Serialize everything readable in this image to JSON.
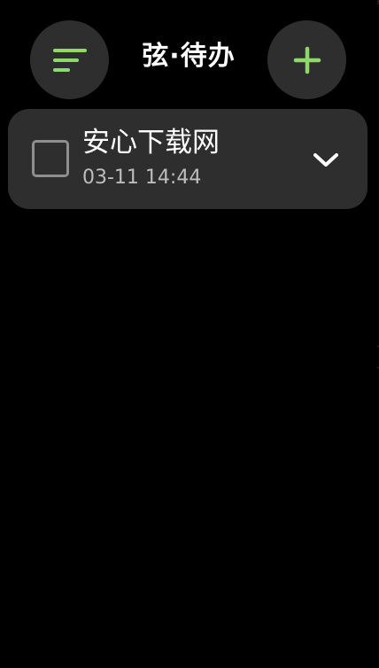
{
  "header": {
    "title": "弦·待办",
    "menu_icon": "sort-lines-icon",
    "add_icon": "plus-icon",
    "accent_color": "#8fd96a"
  },
  "todos": [
    {
      "title": "安心下载网",
      "time": "03-11 14:44",
      "checked": false,
      "expand_icon": "chevron-down-icon"
    }
  ]
}
